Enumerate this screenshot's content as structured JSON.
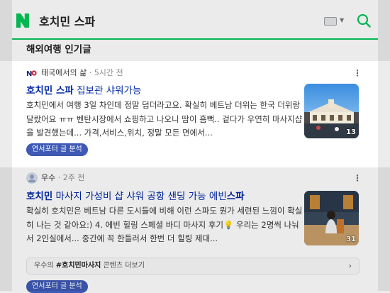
{
  "header": {
    "query": "호치민 스파"
  },
  "section": {
    "title": "해외여행 인기글"
  },
  "posts": [
    {
      "source": "태국에서의 삶",
      "time": "· 5시간 전",
      "title_hl": "호치민 스파",
      "title_rest": " 집보관 샤워가능",
      "description": "호치민에서 여행 3일 차인데 정말 덥더라고요. 확실히 베트남 더위는 한국 더위랑 달랐어요 ㅠㅠ 벤탄시장에서 쇼핑하고 나오니 땀이 흠뻑.. 겉다가 우연히 마사지샵을 발견했는데... 가격,서비스,위치, 정말 모든 면에서...",
      "image_count": "13",
      "chip": "연서포터 글 분석"
    },
    {
      "source": "우수",
      "time": "· 2주 전",
      "title_hl1": "호치민",
      "title_mid": " 마사지 가성비 샵 샤워 공항 샌딩 가능 에빈",
      "title_hl2": "스파",
      "description": "확실히 호치민은 베트남 다른 도시들에 비해 이런 스파도 뭔가 세련된 느낌이 확실히 나는 것 같아요:) 4. 에빈 힐링 스페셜 바디 마사지 후기💡 우리는 2명씩 나눠서 2인실에서... 중간에 꼭 한들러서 한번 더 힐링 제대...",
      "image_count": "31",
      "related_prefix": "우수의 ",
      "related_tag": "#호치민마사지",
      "related_suffix": " 콘텐츠 더보기",
      "chip": "연서포터 글 분석"
    }
  ]
}
